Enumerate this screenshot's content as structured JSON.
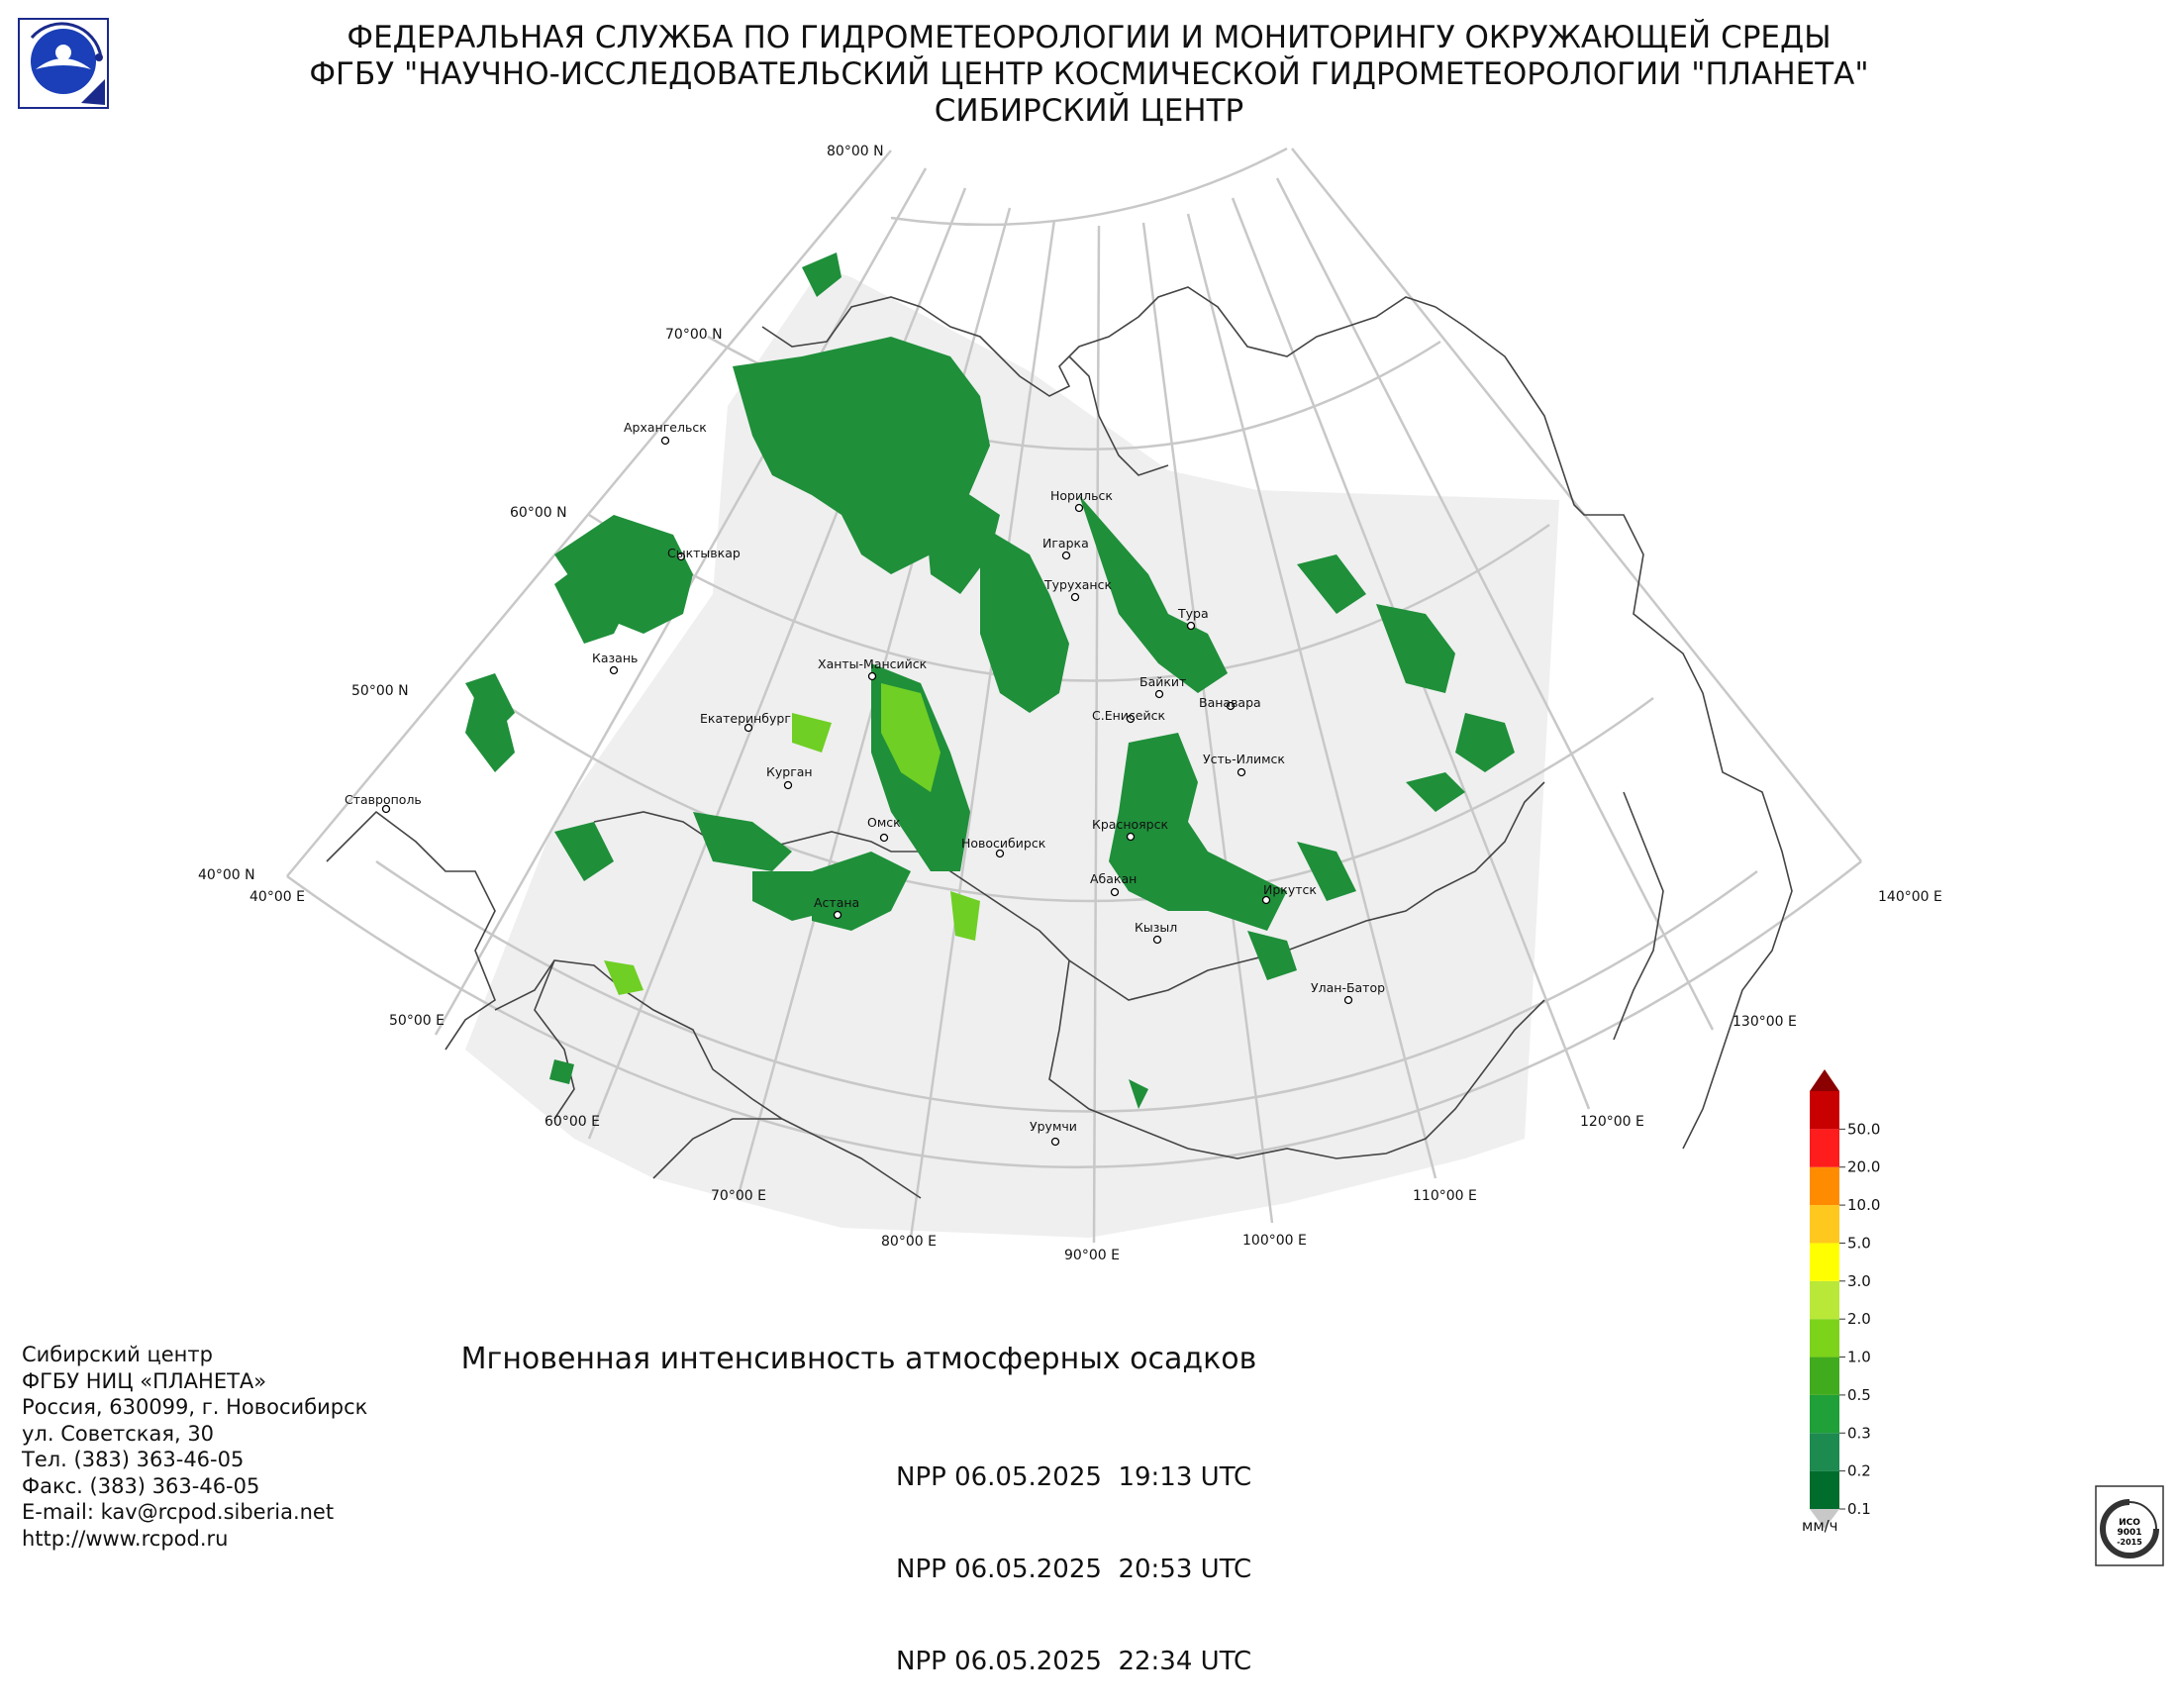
{
  "header": {
    "line1": "ФЕДЕРАЛЬНАЯ СЛУЖБА ПО ГИДРОМЕТЕОРОЛОГИИ И МОНИТОРИНГУ ОКРУЖАЮЩЕЙ СРЕДЫ",
    "line2": "ФГБУ \"НАУЧНО-ИССЛЕДОВАТЕЛЬСКИЙ ЦЕНТР КОСМИЧЕСКОЙ ГИДРОМЕТЕОРОЛОГИИ \"ПЛАНЕТА\"",
    "line3": "СИБИРСКИЙ ЦЕНТР"
  },
  "map": {
    "lat_labels": [
      "80°00 N",
      "70°00 N",
      "60°00 N",
      "50°00 N",
      "40°00 N"
    ],
    "lon_labels": [
      "40°00 E",
      "50°00 E",
      "60°00 E",
      "70°00 E",
      "80°00 E",
      "90°00 E",
      "100°00 E",
      "110°00 E",
      "120°00 E",
      "130°00 E",
      "140°00 E"
    ],
    "cities": [
      {
        "name": "Архангельск"
      },
      {
        "name": "Сыктывкар"
      },
      {
        "name": "Казань"
      },
      {
        "name": "Екатеринбург"
      },
      {
        "name": "Курган"
      },
      {
        "name": "Ставрополь"
      },
      {
        "name": "Ханты-Мансийск"
      },
      {
        "name": "Омск"
      },
      {
        "name": "Астана"
      },
      {
        "name": "Новосибирск"
      },
      {
        "name": "Норильск"
      },
      {
        "name": "Игарка"
      },
      {
        "name": "Туруханск"
      },
      {
        "name": "Тура"
      },
      {
        "name": "Байкит"
      },
      {
        "name": "Ванавара"
      },
      {
        "name": "С.Енисейск"
      },
      {
        "name": "Усть-Илимск"
      },
      {
        "name": "Красноярск"
      },
      {
        "name": "Абакан"
      },
      {
        "name": "Иркутск"
      },
      {
        "name": "Кызыл"
      },
      {
        "name": "Улан-Батор"
      },
      {
        "name": "Урумчи"
      }
    ]
  },
  "product": {
    "title": "Мгновенная интенсивность атмосферных осадков",
    "passes": [
      "NPP 06.05.2025  19:13 UTC",
      "NPP 06.05.2025  20:53 UTC",
      "NPP 06.05.2025  22:34 UTC"
    ]
  },
  "legend": {
    "unit": "мм/ч",
    "levels": [
      "0.1",
      "0.2",
      "0.3",
      "0.5",
      "1.0",
      "2.0",
      "3.0",
      "5.0",
      "10.0",
      "20.0",
      "50.0"
    ],
    "colors": [
      "#006d2c",
      "#1d8a50",
      "#1fa038",
      "#41ab1e",
      "#7dd21a",
      "#b9e838",
      "#ffff00",
      "#ffc81e",
      "#ff8c00",
      "#ff1c1c",
      "#c80000",
      "#8b0000"
    ]
  },
  "contacts": [
    "Сибирский центр",
    "ФГБУ НИЦ «ПЛАНЕТА»",
    "Россия, 630099, г. Новосибирск",
    "ул. Советская, 30",
    "Тел. (383) 363-46-05",
    "Факс. (383) 363-46-05",
    "E-mail: kav@rcpod.siberia.net",
    "http://www.rcpod.ru"
  ],
  "logo_alt": "planeta-logo",
  "iso_badge": {
    "lines": [
      "ИСО",
      "9001",
      "-2015"
    ]
  },
  "colors": {
    "grid": "#c8c8c8",
    "coverage": "#efefef",
    "border": "#444444"
  }
}
